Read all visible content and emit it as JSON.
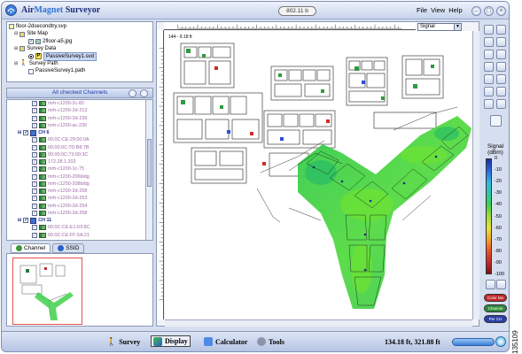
{
  "window": {
    "title_part1": "Air",
    "title_part2": "Magnet",
    "title_part3": " Surveyor",
    "mode_chip": "802.11 b",
    "menu": [
      "File",
      "View",
      "Help"
    ]
  },
  "project_tree": [
    {
      "label": "floor-2dsecondtry.svp",
      "icon": "project-icon",
      "indent": 0
    },
    {
      "label": "Site Map",
      "icon": "folder-icon",
      "indent": 1
    },
    {
      "label": "2floor-a5.jpg",
      "icon": "image-icon",
      "indent": 3
    },
    {
      "label": "Survey Data",
      "icon": "folder-icon",
      "indent": 1
    },
    {
      "label": "PassiveSurvey1.svd",
      "icon": "survey-data-icon",
      "indent": 3,
      "selected": true
    },
    {
      "label": "Survey Path",
      "icon": "folder-icon",
      "indent": 1
    },
    {
      "label": "PassiveSurvey1.path",
      "icon": "path-icon",
      "indent": 3
    }
  ],
  "channels": {
    "header": "All checked Channels",
    "items": [
      {
        "label": "mrh-c1200-2c-82",
        "group": false
      },
      {
        "label": "mrh-c1200-2d-213",
        "group": false
      },
      {
        "label": "mrh-c1200-2d-239",
        "group": false
      },
      {
        "label": "mrh-c1200-ac-230",
        "group": false
      },
      {
        "label": "CH 6",
        "group": true
      },
      {
        "label": "00:0C:CE:29:00:0A",
        "group": false
      },
      {
        "label": "00:00:0C:7D:B8:7B",
        "group": false
      },
      {
        "label": "00:00:0C:73:00:3C",
        "group": false
      },
      {
        "label": "172.28.1.202",
        "group": false
      },
      {
        "label": "mrh-c1200-1c-75",
        "group": false
      },
      {
        "label": "mrh-c1200-206bldg",
        "group": false
      },
      {
        "label": "mrh-c1200-208bldg",
        "group": false
      },
      {
        "label": "mrh-c1200-2d-258",
        "group": false
      },
      {
        "label": "mrh-c1200-2d-253",
        "group": false
      },
      {
        "label": "mrh-c1200-2d-254",
        "group": false
      },
      {
        "label": "mrh-c1200-2d-258",
        "group": false
      },
      {
        "label": "CH 11",
        "group": true
      },
      {
        "label": "00:0C:CE:E1:63:8C",
        "group": false
      },
      {
        "label": "00:0C:CE:FF:5A:21",
        "group": false
      }
    ]
  },
  "tabs": {
    "channel": "Channel",
    "ssid": "SSID"
  },
  "map": {
    "signal_select": "Signal",
    "ruler_label": "144 - 9.18 ft"
  },
  "legend": {
    "title_line1": "Signal",
    "title_line2": "(dBm)",
    "ticks": [
      "0",
      "-10",
      "-20",
      "-30",
      "-40",
      "-50",
      "-60",
      "-70",
      "-80",
      "-90",
      "-100"
    ],
    "pills": [
      {
        "label": "Color Mo",
        "color": "#c0282c"
      },
      {
        "label": "Channel",
        "color": "#2c8a3a"
      },
      {
        "label": "Per CH",
        "color": "#2a3fa8"
      }
    ]
  },
  "statusbar": {
    "survey": "Survey",
    "display": "Display",
    "calculator": "Calculator",
    "tools": "Tools",
    "coords": "134.18 ft, 321.88 ft"
  },
  "figure_number": "135109"
}
